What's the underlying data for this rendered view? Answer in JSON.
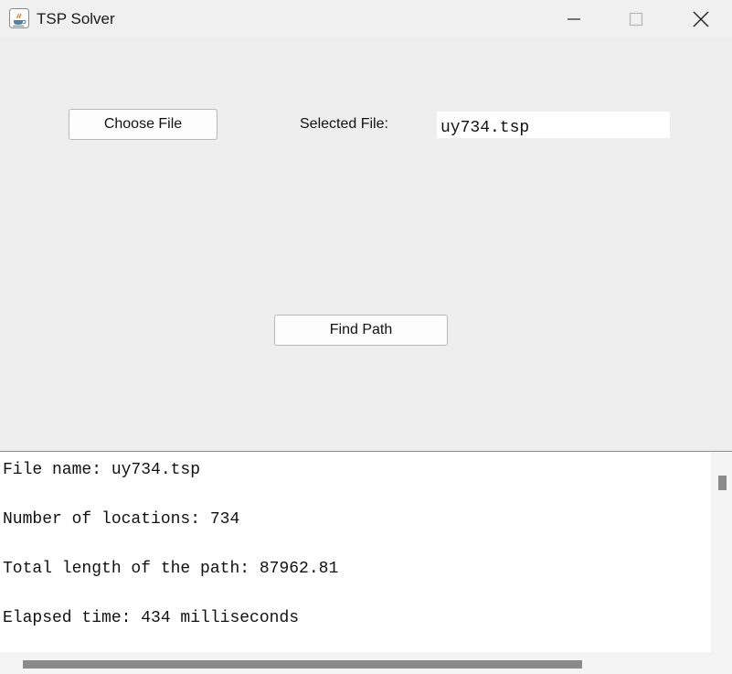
{
  "window": {
    "title": "TSP Solver",
    "icon": "java-icon"
  },
  "controls": {
    "choose_file_label": "Choose File",
    "selected_file_label": "Selected File:",
    "selected_file_value": "uy734.tsp",
    "find_path_label": "Find Path"
  },
  "output": {
    "lines": [
      "File name: uy734.tsp",
      "Number of locations: 734",
      "Total length of the path: 87962.81",
      "Elapsed time: 434 milliseconds"
    ]
  }
}
